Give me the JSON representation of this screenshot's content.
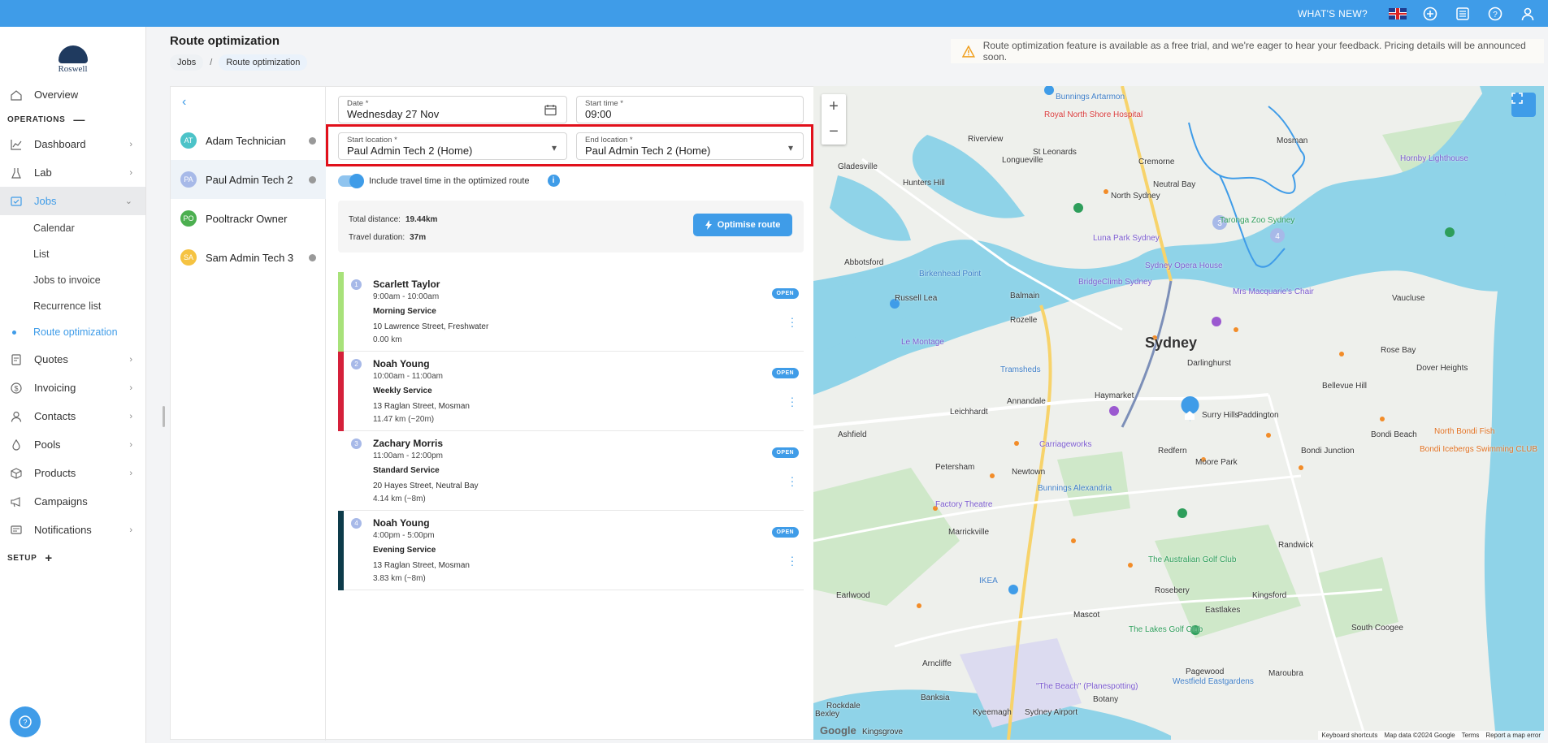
{
  "topbar": {
    "whats_new": "WHAT'S NEW?"
  },
  "sidebar": {
    "brand": "Roswell",
    "overview": "Overview",
    "operations_label": "OPERATIONS",
    "items": [
      {
        "label": "Dashboard"
      },
      {
        "label": "Lab"
      },
      {
        "label": "Jobs"
      }
    ],
    "jobs_sub": [
      "Calendar",
      "List",
      "Jobs to invoice",
      "Recurrence list",
      "Route optimization"
    ],
    "items2": [
      {
        "label": "Quotes"
      },
      {
        "label": "Invoicing"
      },
      {
        "label": "Contacts"
      },
      {
        "label": "Pools"
      },
      {
        "label": "Products"
      },
      {
        "label": "Campaigns"
      },
      {
        "label": "Notifications"
      }
    ],
    "setup_label": "SETUP"
  },
  "header": {
    "title": "Route optimization",
    "breadcrumb": [
      "Jobs",
      "Route optimization"
    ],
    "notice": "Route optimization feature is available as a free trial, and we're eager to hear your feedback. Pricing details will be announced soon."
  },
  "technicians": [
    {
      "initials": "AT",
      "name": "Adam Technician",
      "color": "#4cc3c8"
    },
    {
      "initials": "PA",
      "name": "Paul Admin Tech 2",
      "color": "#a7b9e8"
    },
    {
      "initials": "PO",
      "name": "Pooltrackr Owner",
      "color": "#4caf50"
    },
    {
      "initials": "SA",
      "name": "Sam Admin Tech 3",
      "color": "#f5c342"
    }
  ],
  "form": {
    "date_label": "Date *",
    "date_value": "Wednesday 27 Nov",
    "start_time_label": "Start time *",
    "start_time_value": "09:00",
    "start_location_label": "Start location *",
    "start_location_value": "Paul Admin Tech 2 (Home)",
    "end_location_label": "End location *",
    "end_location_value": "Paul Admin Tech 2 (Home)",
    "travel_toggle_label": "Include travel time in the optimized route"
  },
  "summary": {
    "distance_label": "Total distance:",
    "distance_value": "19.44km",
    "duration_label": "Travel duration:",
    "duration_value": "37m",
    "optimise_button": "Optimise route"
  },
  "stops": [
    {
      "num": "1",
      "name": "Scarlett Taylor",
      "time": "9:00am - 10:00am",
      "service": "Morning Service",
      "address": "10 Lawrence Street, Freshwater",
      "distance": "0.00 km",
      "status": "OPEN",
      "color": "#a8e27a"
    },
    {
      "num": "2",
      "name": "Noah Young",
      "time": "10:00am - 11:00am",
      "service": "Weekly Service",
      "address": "13 Raglan Street, Mosman",
      "distance": "11.47 km (~20m)",
      "status": "OPEN",
      "color": "#d5203a"
    },
    {
      "num": "3",
      "name": "Zachary Morris",
      "time": "11:00am - 12:00pm",
      "service": "Standard Service",
      "address": "20 Hayes Street, Neutral Bay",
      "distance": "4.14 km (~8m)",
      "status": "OPEN",
      "color": "#ffffff"
    },
    {
      "num": "4",
      "name": "Noah Young",
      "time": "4:00pm - 5:00pm",
      "service": "Evening Service",
      "address": "13 Raglan Street, Mosman",
      "distance": "3.83 km (~8m)",
      "status": "OPEN",
      "color": "#0d3b4a"
    }
  ],
  "map": {
    "labels": [
      "Sydney",
      "Riverview",
      "Longueville",
      "Gladesville",
      "Hunters Hill",
      "Abbotsford",
      "Russell Lea",
      "Balmain",
      "Rozelle",
      "Annandale",
      "Leichhardt",
      "Ashfield",
      "Petersham",
      "Newtown",
      "Redfern",
      "Marrickville",
      "Earlwood",
      "Arncliffe",
      "Banksia",
      "Kyeemagh",
      "Sydney Airport",
      "Botany",
      "Mascot",
      "Rosebery",
      "Eastlakes",
      "Kingsford",
      "Randwick",
      "Maroubra",
      "Pagewood",
      "Bondi Junction",
      "Bondi Beach",
      "Paddington",
      "Darlinghurst",
      "Surry Hills",
      "Haymarket",
      "Moore Park",
      "Cremorne",
      "Neutral Bay",
      "North Sydney",
      "Mosman",
      "St Leonards",
      "Vaucluse",
      "Rose Bay",
      "Dover Heights",
      "Bellevue Hill",
      "South Coogee",
      "Rockdale",
      "Bexley",
      "Kingsgrove"
    ],
    "pois": [
      "Royal North Shore Hospital",
      "Bunnings Artarmon",
      "Taronga Zoo Sydney",
      "Sydney Opera House",
      "Luna Park Sydney",
      "BridgeClimb Sydney",
      "Mrs Macquarie's Chair",
      "Hornby Lighthouse",
      "The Australian Golf Club",
      "The Lakes Golf Club",
      "Bunnings Alexandria",
      "IKEA",
      "Factory Theatre",
      "Carriageworks",
      "Tramsheds",
      "Le Montage",
      "Birkenhead Point",
      "Westfield Eastgardens",
      "\"The Beach\" (Planespotting)",
      "North Bondi Fish",
      "Bondi Icebergs Swimming CLUB"
    ],
    "footer": [
      "Keyboard shortcuts",
      "Map data ©2024 Google",
      "Terms",
      "Report a map error"
    ],
    "google": "Google"
  }
}
